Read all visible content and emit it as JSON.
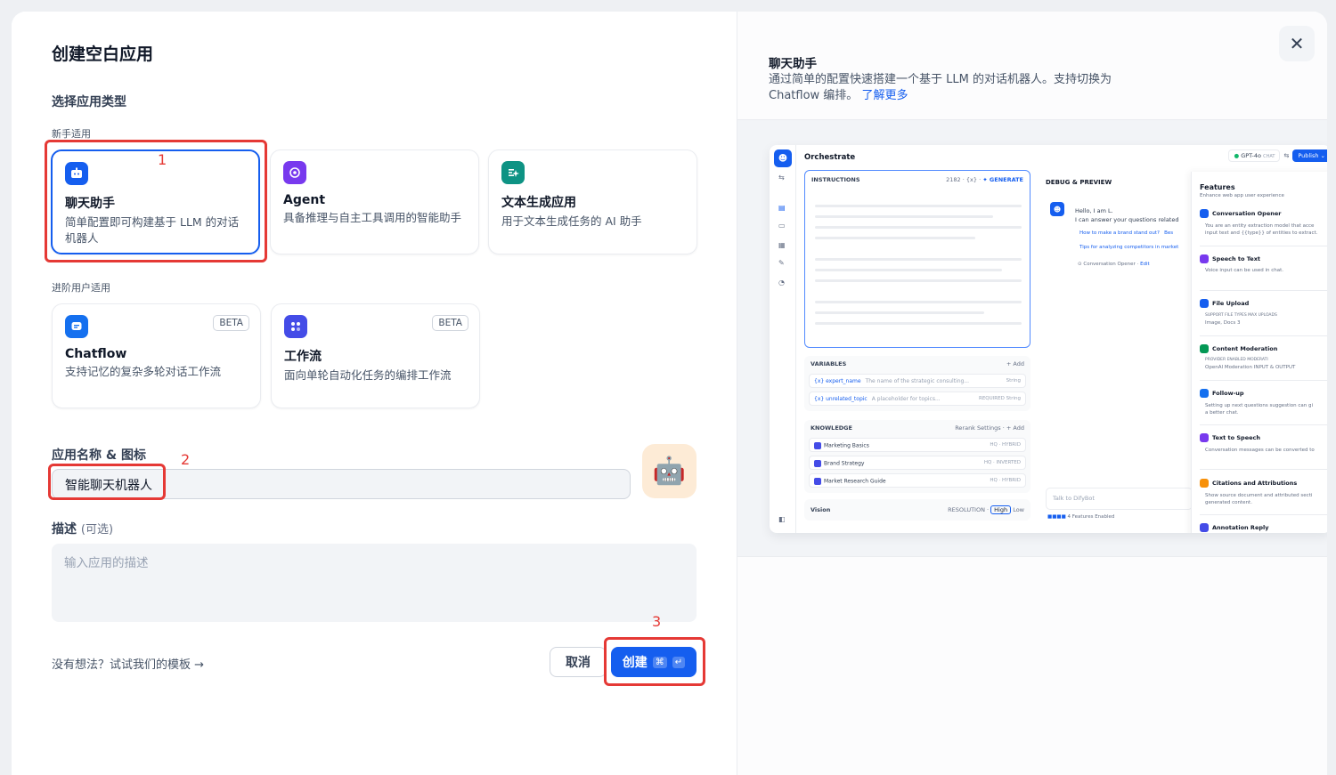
{
  "left": {
    "title": "创建空白应用",
    "section_title": "选择应用类型",
    "group_beginner": "新手适用",
    "group_advanced": "进阶用户适用",
    "cards": [
      {
        "title": "聊天助手",
        "desc": "简单配置即可构建基于 LLM 的对话机器人",
        "color": "#155eef"
      },
      {
        "title": "Agent",
        "desc": "具备推理与自主工具调用的智能助手",
        "color": "#7839ee"
      },
      {
        "title": "文本生成应用",
        "desc": "用于文本生成任务的 AI 助手",
        "color": "#0e9384"
      },
      {
        "title": "Chatflow",
        "desc": "支持记忆的复杂多轮对话工作流",
        "badge": "BETA",
        "color": "#1570ef"
      },
      {
        "title": "工作流",
        "desc": "面向单轮自动化任务的编排工作流",
        "badge": "BETA",
        "color": "#444ce7"
      }
    ],
    "name_label": "应用名称 & 图标",
    "name_value": "智能聊天机器人",
    "avatar_emoji": "🤖",
    "desc_label": "描述",
    "desc_optional": "(可选)",
    "desc_placeholder": "输入应用的描述",
    "template_link": "没有想法？试试我们的模板 →",
    "cancel_label": "取消",
    "create_label": "创建",
    "create_kbd1": "⌘",
    "create_kbd2": "↵",
    "annotations": [
      "1",
      "2",
      "3"
    ],
    "annotation_color": "#e53935"
  },
  "right": {
    "close_glyph": "✕",
    "title": "聊天助手",
    "desc": "通过简单的配置快速搭建一个基于 LLM 的对话机器人。支持切换为 Chatflow 编排。",
    "learn_more": "了解更多",
    "preview": {
      "orchestrate": "Orchestrate",
      "model": "GPT-4o",
      "model_mode": "CHAT",
      "publish": "Publish",
      "instructions": "INSTRUCTIONS",
      "instr_count": "2182",
      "instr_var": "{x}",
      "generate": "✦ GENERATE",
      "variables": "VARIABLES",
      "add": "+ Add",
      "vars": [
        {
          "key": "{x} expert_name",
          "desc": "The name of the strategic consulting...",
          "type": "String",
          "required": ""
        },
        {
          "key": "{x} unrelated_topic",
          "desc": "A placeholder for topics...",
          "type": "String",
          "required": "REQUIRED"
        }
      ],
      "knowledge": "KNOWLEDGE",
      "rerank": "Rerank Settings",
      "kbs": [
        {
          "name": "Marketing Basics",
          "tag": "HQ · HYBRID"
        },
        {
          "name": "Brand Strategy",
          "tag": "HQ · INVERTED"
        },
        {
          "name": "Market Research Guide",
          "tag": "HQ · HYBRID"
        }
      ],
      "vision": "Vision",
      "resolution": "RESOLUTION",
      "high": "High",
      "low": "Low",
      "debug": "DEBUG & PREVIEW",
      "hello": "Hello, I am L.",
      "can_answer": "I can answer your questions related",
      "sugg1": "How to make a brand stand out?",
      "sugg1_tail": "Bes",
      "sugg2": "Tips for analyzing competitors in market",
      "opener_note": "Conversation Opener",
      "edit": "Edit",
      "talk_placeholder": "Talk to DifyBot",
      "features_enabled": "4 Features Enabled",
      "features_title": "Features",
      "features_sub": "Enhance web app user experience",
      "features": [
        {
          "name": "Conversation Opener",
          "desc": "You are an entity extraction model that acce",
          "desc2": "input text and {{type}} of entities to extract.",
          "color": "#155eef"
        },
        {
          "name": "Speech to Text",
          "desc": "Voice input can be used in chat.",
          "desc2": "",
          "color": "#7839ee"
        },
        {
          "name": "File Upload",
          "desc": "SUPPORT FILE TYPES       MAX UPLOADS",
          "desc2": "Image, Docs                     3",
          "color": "#155eef"
        },
        {
          "name": "Content Moderation",
          "desc": "PROVIDER                      ENABLED MODERATI",
          "desc2": "OpenAI Moderation          INPUT & OUTPUT",
          "color": "#039855"
        },
        {
          "name": "Follow-up",
          "desc": "Setting up next questions suggestion can gi",
          "desc2": "a better chat.",
          "color": "#1570ef"
        },
        {
          "name": "Text to Speech",
          "desc": "Conversation messages can be converted to",
          "desc2": "",
          "color": "#7839ee"
        },
        {
          "name": "Citations and Attributions",
          "desc": "Show source document and attributed secti",
          "desc2": "generated content.",
          "color": "#f79009"
        },
        {
          "name": "Annotation Reply",
          "desc": "",
          "desc2": "",
          "color": "#444ce7"
        }
      ]
    }
  }
}
